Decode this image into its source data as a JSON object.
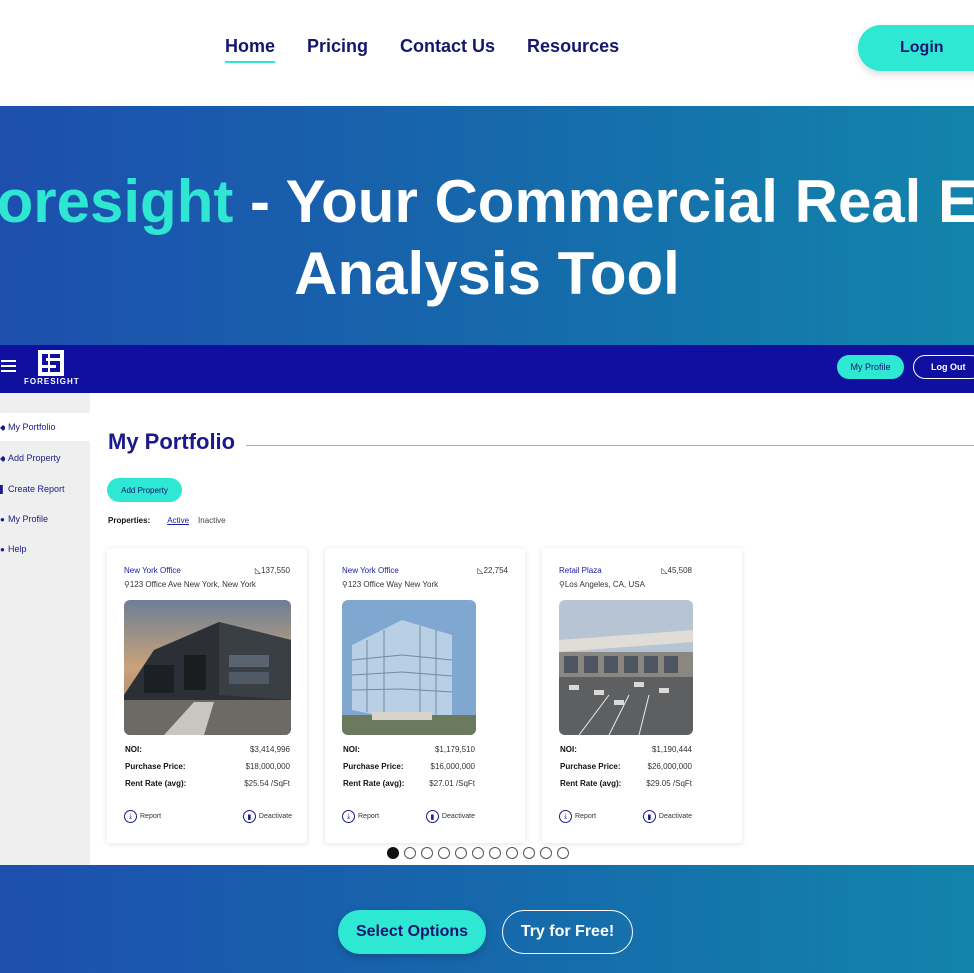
{
  "nav": {
    "links": [
      "Home",
      "Pricing",
      "Contact Us",
      "Resources"
    ],
    "active": "Home",
    "login_label": "Login"
  },
  "hero": {
    "title_accent": "Foresight",
    "title_rest": " - Your Commercial Real Estate",
    "title_line2": "Analysis Tool"
  },
  "app": {
    "logo_text": "FORESIGHT",
    "my_profile_label": "My Profile",
    "logout_label": "Log Out",
    "sidebar": [
      {
        "label": "My Portfolio",
        "icon": "portfolio-icon"
      },
      {
        "label": "Add Property",
        "icon": "add-icon"
      },
      {
        "label": "Create Report",
        "icon": "report-icon"
      },
      {
        "label": "My Profile",
        "icon": "profile-icon"
      },
      {
        "label": "Help",
        "icon": "help-icon"
      }
    ],
    "page_title": "My Portfolio",
    "add_property_label": "Add Property",
    "properties_label": "Properties:",
    "filter_active": "Active",
    "filter_inactive": "Inactive",
    "stat_labels": {
      "noi": "NOI:",
      "price": "Purchase Price:",
      "rent": "Rent Rate (avg):"
    },
    "report_label": "Report",
    "deactivate_label": "Deactivate",
    "cards": [
      {
        "name": "New York Office",
        "sqft": "137,550",
        "address": "123 Office Ave New York, New York",
        "noi": "$3,414,996",
        "price": "$18,000,000",
        "rent": "$25.54 /SqFt"
      },
      {
        "name": "New York Office",
        "sqft": "22,754",
        "address": "123 Office Way New York",
        "noi": "$1,179,510",
        "price": "$16,000,000",
        "rent": "$27.01 /SqFt"
      },
      {
        "name": "Retail Plaza",
        "sqft": "45,508",
        "address": "Los Angeles, CA, USA",
        "noi": "$1,190,444",
        "price": "$26,000,000",
        "rent": "$29.05 /SqFt"
      }
    ],
    "pagination": {
      "total": 11,
      "current": 1
    }
  },
  "cta": {
    "select_label": "Select Options",
    "try_label": "Try for Free!"
  },
  "colors": {
    "accent": "#2ee8d4",
    "navy": "#1010a0",
    "text_navy": "#16166e"
  }
}
